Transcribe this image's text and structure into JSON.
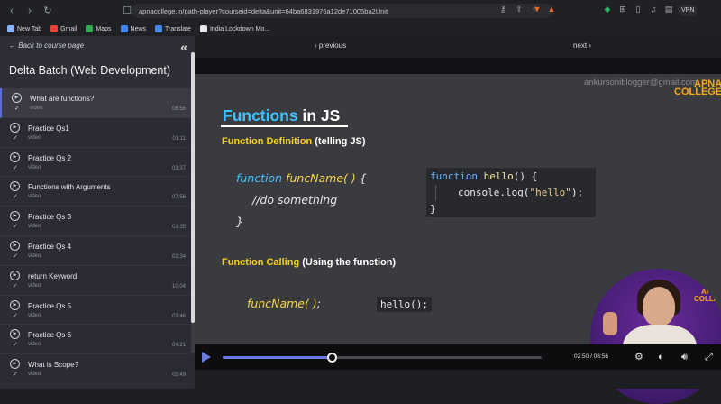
{
  "browser": {
    "url": "apnacollege.in/path-player?courseid=delta&unit=64ba6831976a12de71005ba2Unit",
    "vpn_label": "VPN",
    "bookmarks": [
      {
        "label": "New Tab",
        "color": "#8ab4f8"
      },
      {
        "label": "Gmail",
        "color": "#ea4335"
      },
      {
        "label": "Maps",
        "color": "#34a853"
      },
      {
        "label": "News",
        "color": "#4285f4"
      },
      {
        "label": "Translate",
        "color": "#4285f4"
      },
      {
        "label": "India Lockdown Mo...",
        "color": "#e8e8e8"
      }
    ]
  },
  "sidebar": {
    "back_label": "← Back to course page",
    "course_title": "Delta Batch (Web Development)",
    "lessons": [
      {
        "title": "What are functions?",
        "type": "video",
        "duration": "06:56"
      },
      {
        "title": "Practice Qs1",
        "type": "video",
        "duration": "01:11"
      },
      {
        "title": "Practice Qs 2",
        "type": "video",
        "duration": "03:37"
      },
      {
        "title": "Functions with Arguments",
        "type": "video",
        "duration": "07:56"
      },
      {
        "title": "Practice Qs 3",
        "type": "video",
        "duration": "03:35"
      },
      {
        "title": "Practice Qs 4",
        "type": "video",
        "duration": "02:34"
      },
      {
        "title": "return Keyword",
        "type": "video",
        "duration": "10:04"
      },
      {
        "title": "Practice Qs 5",
        "type": "video",
        "duration": "03:46"
      },
      {
        "title": "Practice Qs 6",
        "type": "video",
        "duration": "04:21"
      },
      {
        "title": "What is Scope?",
        "type": "video",
        "duration": "05:49"
      }
    ]
  },
  "player": {
    "prev_label": "‹ previous",
    "next_label": "next ›",
    "time_label": "02:50 / 08:56",
    "progress_fraction": 0.342,
    "accent": "#6a7ae0"
  },
  "slide": {
    "watermark": "ankursoniblogger@gmail.com",
    "logo_line1": "APNA",
    "logo_line2": "COLLEGE",
    "title_main": "Functions",
    "title_rest": " in JS",
    "sub1_main": "Function Definition",
    "sub1_rest": " (telling JS)",
    "code1_kw": "function ",
    "code1_fn": "funcName( )",
    "code1_brace": " {",
    "code1_body": "//do something",
    "code1_close": "}",
    "code2_kw": "function ",
    "code2_fn": "hello",
    "code2_sig": "() {",
    "code2_body_a": "console.log(",
    "code2_body_str": "\"hello\"",
    "code2_body_b": ");",
    "code2_close": "}",
    "sub2_main": "Function Calling",
    "sub2_rest": " (Using the function)",
    "code3_fn": "funcName( )",
    "code3_end": ";",
    "code4": "hello();"
  }
}
